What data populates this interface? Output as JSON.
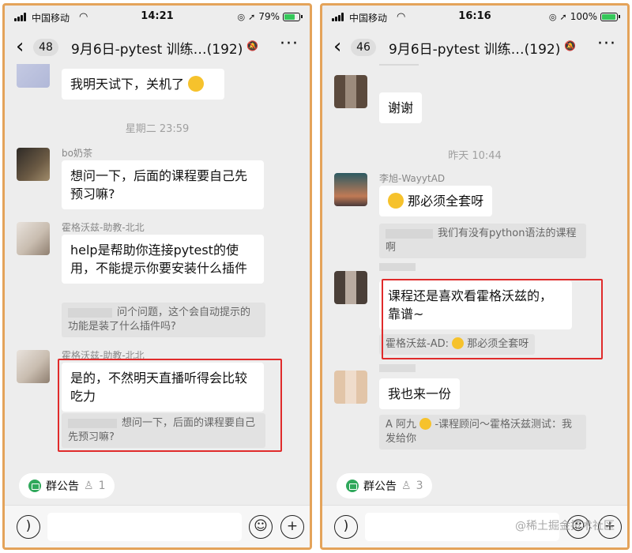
{
  "colors": {
    "frame": "#e4a35a",
    "chat_bg": "#ededed",
    "bubble": "#ffffff",
    "quote": "#e2e2e2",
    "highlight": "#e02b2b",
    "notice_green": "#2fa85b"
  },
  "left": {
    "status": {
      "carrier": "中国移动",
      "time": "14:21",
      "battery": "79%",
      "battery_level": 0.79
    },
    "header": {
      "unread": "48",
      "title": "9月6日-pytest 训练…(192)"
    },
    "messages": {
      "m1_text": "我明天试下，关机了",
      "timestamp": "星期二 23:59",
      "m2_sender": "bo奶茶",
      "m2_text": "想问一下，后面的课程要自己先预习嘛?",
      "m3_sender": "霍格沃兹-助教-北北",
      "m3_text": "help是帮助你连接pytest的使用，不能提示你要安装什么插件",
      "m3_quote": "问个问题，这个会自动提示的功能是装了什么插件吗?",
      "m4_sender": "霍格沃兹-助教-北北",
      "m4_text": "是的，不然明天直播听得会比较吃力",
      "m4_quote": "想问一下，后面的课程要自己先预习嘛?"
    },
    "notice": {
      "label": "群公告",
      "count": "1"
    }
  },
  "right": {
    "status": {
      "carrier": "中国移动",
      "time": "16:16",
      "battery": "100%",
      "battery_level": 1.0
    },
    "header": {
      "unread": "46",
      "title": "9月6日-pytest 训练…(192)"
    },
    "messages": {
      "m1_text": "谢谢",
      "timestamp": "昨天 10:44",
      "m2_sender": "李旭-WayytAD",
      "m2_text": "那必须全套呀",
      "m2_quote": "我们有没有python语法的课程啊",
      "m3_text": "课程还是喜欢看霍格沃兹的，靠谱~",
      "m3_quote_prefix": "霍格沃兹-AD:",
      "m3_quote_text": "那必须全套呀",
      "m4_text": "我也来一份",
      "m4_quote_prefix": "A 阿九",
      "m4_quote": "-课程顾问～霍格沃兹测试：我发给你"
    },
    "notice": {
      "label": "群公告",
      "count": "3"
    },
    "watermark": "@稀土掘金技术社区"
  }
}
